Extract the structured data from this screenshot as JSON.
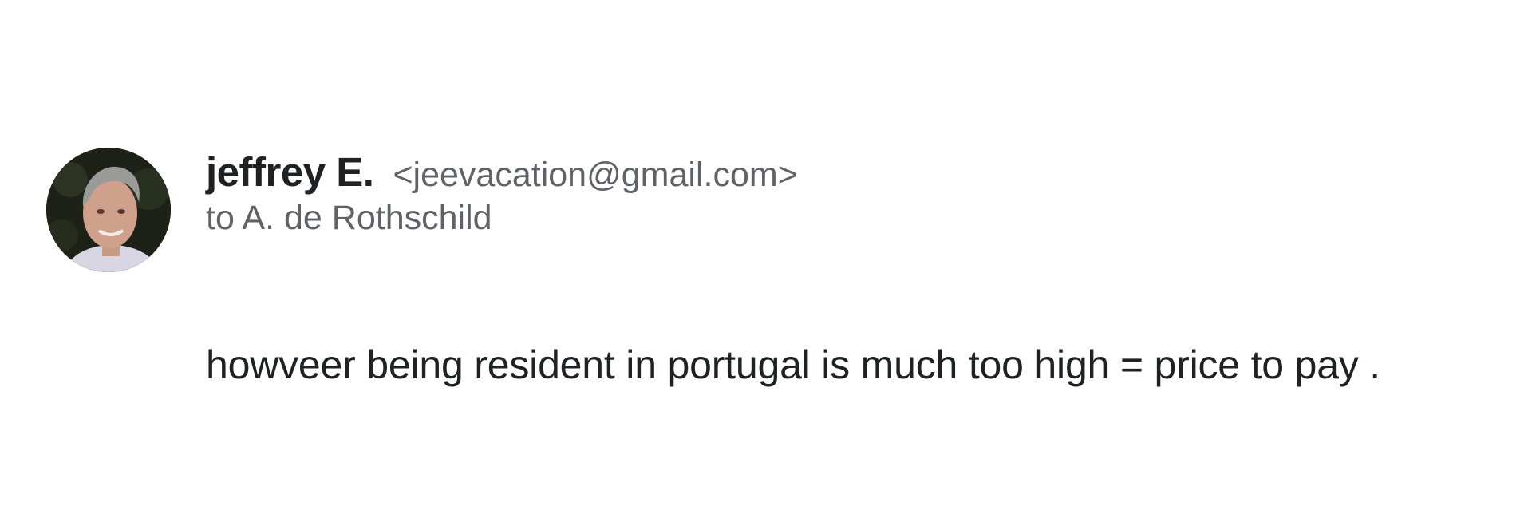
{
  "message": {
    "sender": {
      "name": "jeffrey E.",
      "email": "<jeevacation@gmail.com>"
    },
    "recipient_line": "to A. de Rothschild",
    "body": "howveer being resident in portugal is much too high = price to pay ."
  },
  "avatar": {
    "icon": "sender-avatar-photo"
  }
}
